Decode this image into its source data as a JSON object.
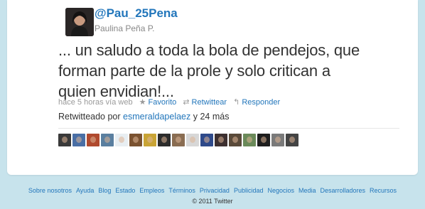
{
  "tweet": {
    "screen_name": "@Pau_25Pena",
    "full_name": "Paulina Peña P.",
    "text_lines": [
      "... un saludo a toda la bola de pendejos, que",
      "forman parte de la prole y solo critican a",
      "quien envidian!..."
    ],
    "time": "hace 5 horas vía web",
    "actions": {
      "favorite": "Favorito",
      "retweet": "Retwittear",
      "reply": "Responder"
    },
    "retweeted_prefix": "Retwitteado por",
    "retweeted_user": "esmeraldapelaez",
    "retweeted_suffix": "y 24 más"
  },
  "retweeters": [
    {
      "name": "retweeter-1",
      "color": "#3a3a3a"
    },
    {
      "name": "retweeter-2",
      "color": "#4a6fa5"
    },
    {
      "name": "retweeter-3",
      "color": "#b04a2e"
    },
    {
      "name": "retweeter-4",
      "color": "#5a7fa0"
    },
    {
      "name": "retweeter-5",
      "color": "#e8eef2"
    },
    {
      "name": "retweeter-6",
      "color": "#7a5230"
    },
    {
      "name": "retweeter-7",
      "color": "#c9a436"
    },
    {
      "name": "retweeter-8",
      "color": "#2c2c2c"
    },
    {
      "name": "retweeter-9",
      "color": "#8a6d52"
    },
    {
      "name": "retweeter-10",
      "color": "#d7d7d7"
    },
    {
      "name": "retweeter-11",
      "color": "#2f4a8a"
    },
    {
      "name": "retweeter-12",
      "color": "#3d3030"
    },
    {
      "name": "retweeter-13",
      "color": "#5a4a3a"
    },
    {
      "name": "retweeter-14",
      "color": "#6b8a5a"
    },
    {
      "name": "retweeter-15",
      "color": "#1e1e1e"
    },
    {
      "name": "retweeter-16",
      "color": "#7a7a7a"
    },
    {
      "name": "retweeter-17",
      "color": "#444444"
    }
  ],
  "footer": {
    "links": [
      "Sobre nosotros",
      "Ayuda",
      "Blog",
      "Estado",
      "Empleos",
      "Términos",
      "Privacidad",
      "Publicidad",
      "Negocios",
      "Media",
      "Desarrolladores",
      "Recursos"
    ],
    "copyright": "© 2011 Twitter"
  },
  "colors": {
    "background": "#c7e3ec",
    "link": "#2276bb",
    "text": "#333333",
    "muted": "#999999"
  }
}
